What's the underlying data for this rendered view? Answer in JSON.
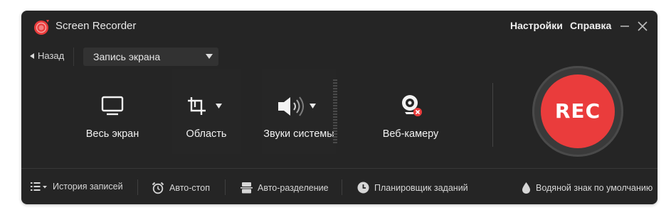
{
  "app": {
    "title": "Screen Recorder",
    "accent_color": "#ea3c3c"
  },
  "header": {
    "settings_label": "Настройки",
    "help_label": "Справка",
    "minimize_icon": "minimize-icon",
    "close_icon": "close-icon"
  },
  "toolbar": {
    "back_label": "Назад",
    "mode_value": "Запись экрана"
  },
  "tiles": [
    {
      "label": "Весь экран",
      "icon": "monitor-icon"
    },
    {
      "label": "Область",
      "icon": "crop-icon"
    },
    {
      "label": "Звуки системы",
      "icon": "speaker-icon"
    },
    {
      "label": "Веб-камеру",
      "icon": "webcam-icon"
    }
  ],
  "rec": {
    "label": "REC"
  },
  "bottom": {
    "history_label": "История записей",
    "autostop_label": "Авто-стоп",
    "autosplit_label": "Авто-разделение",
    "scheduler_label": "Планировщик заданий",
    "watermark_label": "Водяной знак по умолчанию"
  }
}
